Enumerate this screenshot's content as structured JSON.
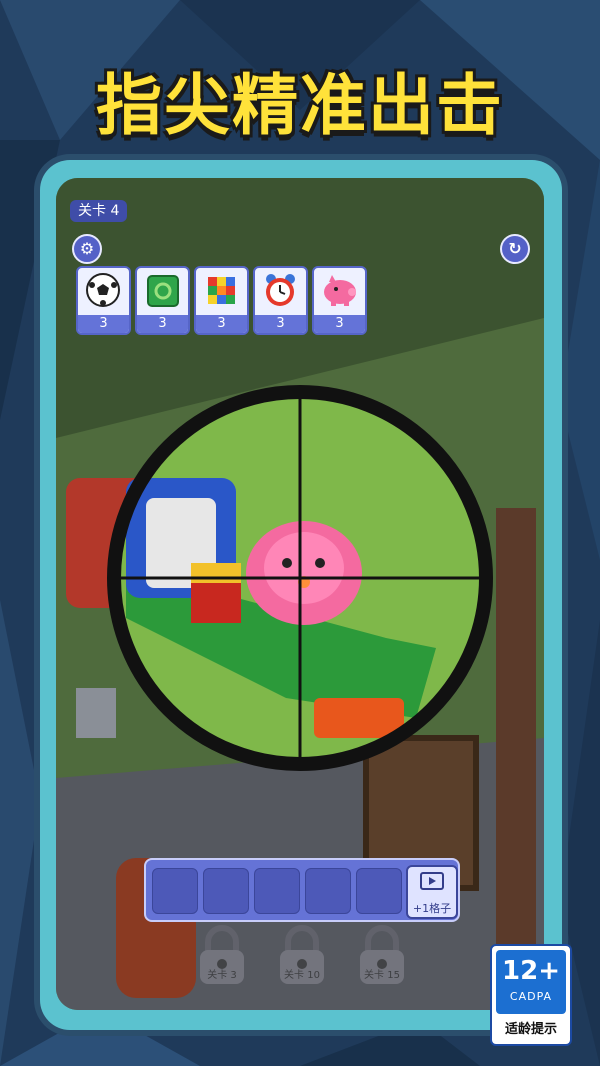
{
  "promo": {
    "headline": "指尖精准出击"
  },
  "hud": {
    "level_label": "关卡",
    "level_number": "4",
    "settings_icon": "gear-icon",
    "restart_icon": "refresh-icon"
  },
  "targets": [
    {
      "name": "soccer-ball",
      "count": "3"
    },
    {
      "name": "green-cube",
      "count": "3"
    },
    {
      "name": "rubiks-cube",
      "count": "3"
    },
    {
      "name": "alarm-clock",
      "count": "3"
    },
    {
      "name": "piggy-bank",
      "count": "3"
    }
  ],
  "slots": {
    "empty_count": 5,
    "ad_slot_label": "+1格子",
    "ad_icon": "video-icon"
  },
  "locked_levels": [
    {
      "label": "关卡 3"
    },
    {
      "label": "关卡 10"
    },
    {
      "label": "关卡 15"
    }
  ],
  "rating": {
    "age": "12+",
    "org": "CADPA",
    "tip": "适龄提示"
  },
  "colors": {
    "headline": "#ffe23a",
    "frame": "#5bc2cf",
    "panel": "#6573d6",
    "badge": "#3f4da8",
    "rating_blue": "#1c6fd1"
  }
}
